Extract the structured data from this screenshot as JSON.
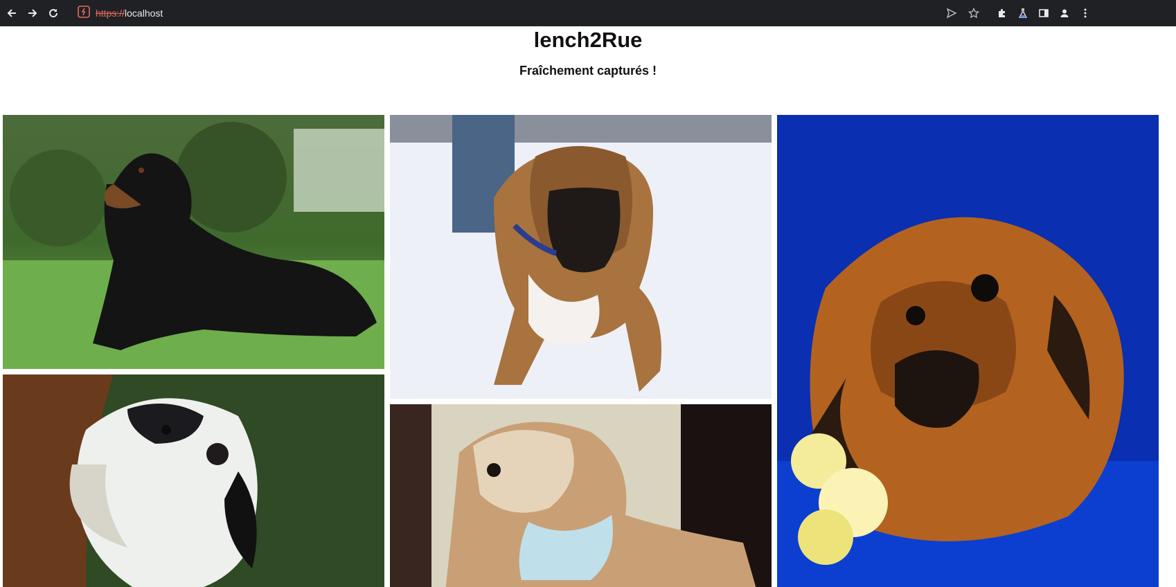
{
  "browser": {
    "url_scheme": "https://",
    "url_host": "localhost",
    "icons": [
      "back-arrow-icon",
      "forward-arrow-icon",
      "reload-icon",
      "site-info-icon",
      "send-icon",
      "star-icon",
      "puzzle-icon",
      "lab-flask-icon",
      "side-panel-icon",
      "profile-icon",
      "kebab-menu-icon"
    ]
  },
  "header": {
    "title": "lench2Rue",
    "subtitle": "Fraîchement capturés !"
  },
  "gallery": {
    "photos": [
      {
        "name": "gordon-setter-photo",
        "subject": "black and tan dog lying on grass"
      },
      {
        "name": "boxer-photo",
        "subject": "boxer dog on snow"
      },
      {
        "name": "pekingese-photo",
        "subject": "pekingese dog on blue background with flowers"
      },
      {
        "name": "setter-puppy-photo",
        "subject": "white and black puppy"
      },
      {
        "name": "shih-tzu-photo",
        "subject": "fluffy dog with bandana"
      }
    ]
  }
}
